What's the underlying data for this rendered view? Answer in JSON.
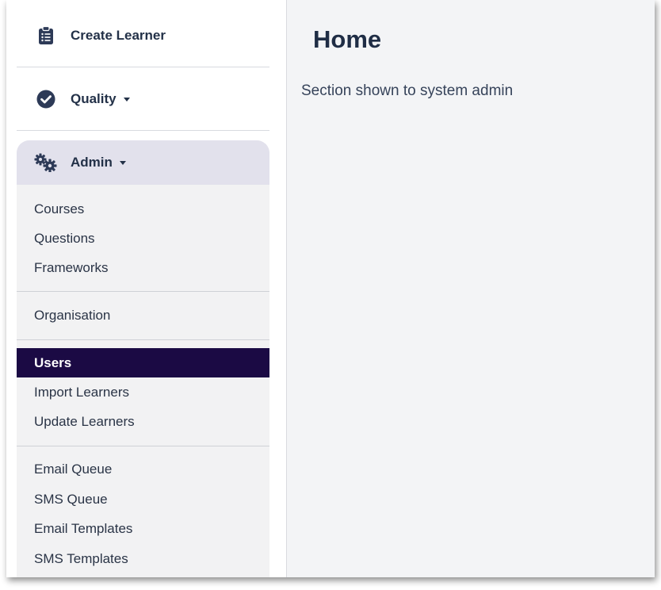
{
  "sidebar": {
    "create_learner": {
      "label": "Create Learner",
      "icon": "clipboard-list-icon"
    },
    "quality": {
      "label": "Quality",
      "icon": "check-circle-icon"
    },
    "admin": {
      "label": "Admin",
      "icon": "cogs-icon",
      "groups": [
        [
          "Courses",
          "Questions",
          "Frameworks"
        ],
        [
          "Organisation"
        ],
        [
          "Users",
          "Import Learners",
          "Update Learners"
        ],
        [
          "Email Queue",
          "SMS Queue",
          "Email Templates",
          "SMS Templates"
        ]
      ],
      "active_item": "Users"
    }
  },
  "main": {
    "title": "Home",
    "text": "Section shown to system admin"
  },
  "colors": {
    "accent_active": "#1b0a44",
    "admin_header_bg": "#e2e1ec",
    "text_dark": "#233148",
    "page_bg": "#f3f4f6"
  }
}
